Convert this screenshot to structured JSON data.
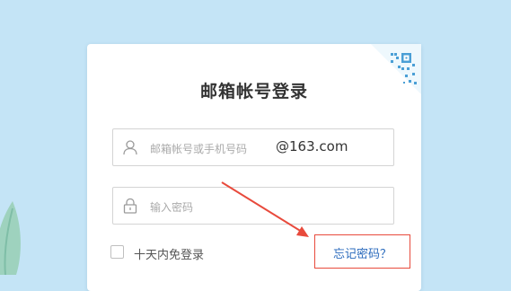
{
  "login": {
    "title": "邮箱帐号登录",
    "account": {
      "placeholder": "邮箱帐号或手机号码",
      "suffix": "@163.com",
      "icon": "user-icon"
    },
    "password": {
      "placeholder": "输入密码",
      "icon": "lock-icon"
    },
    "remember_label": "十天内免登录",
    "forgot_label": "忘记密码？"
  },
  "colors": {
    "background": "#c4e4f6",
    "card": "#ffffff",
    "annotation": "#e84a3c",
    "link": "#2b6bbd"
  }
}
